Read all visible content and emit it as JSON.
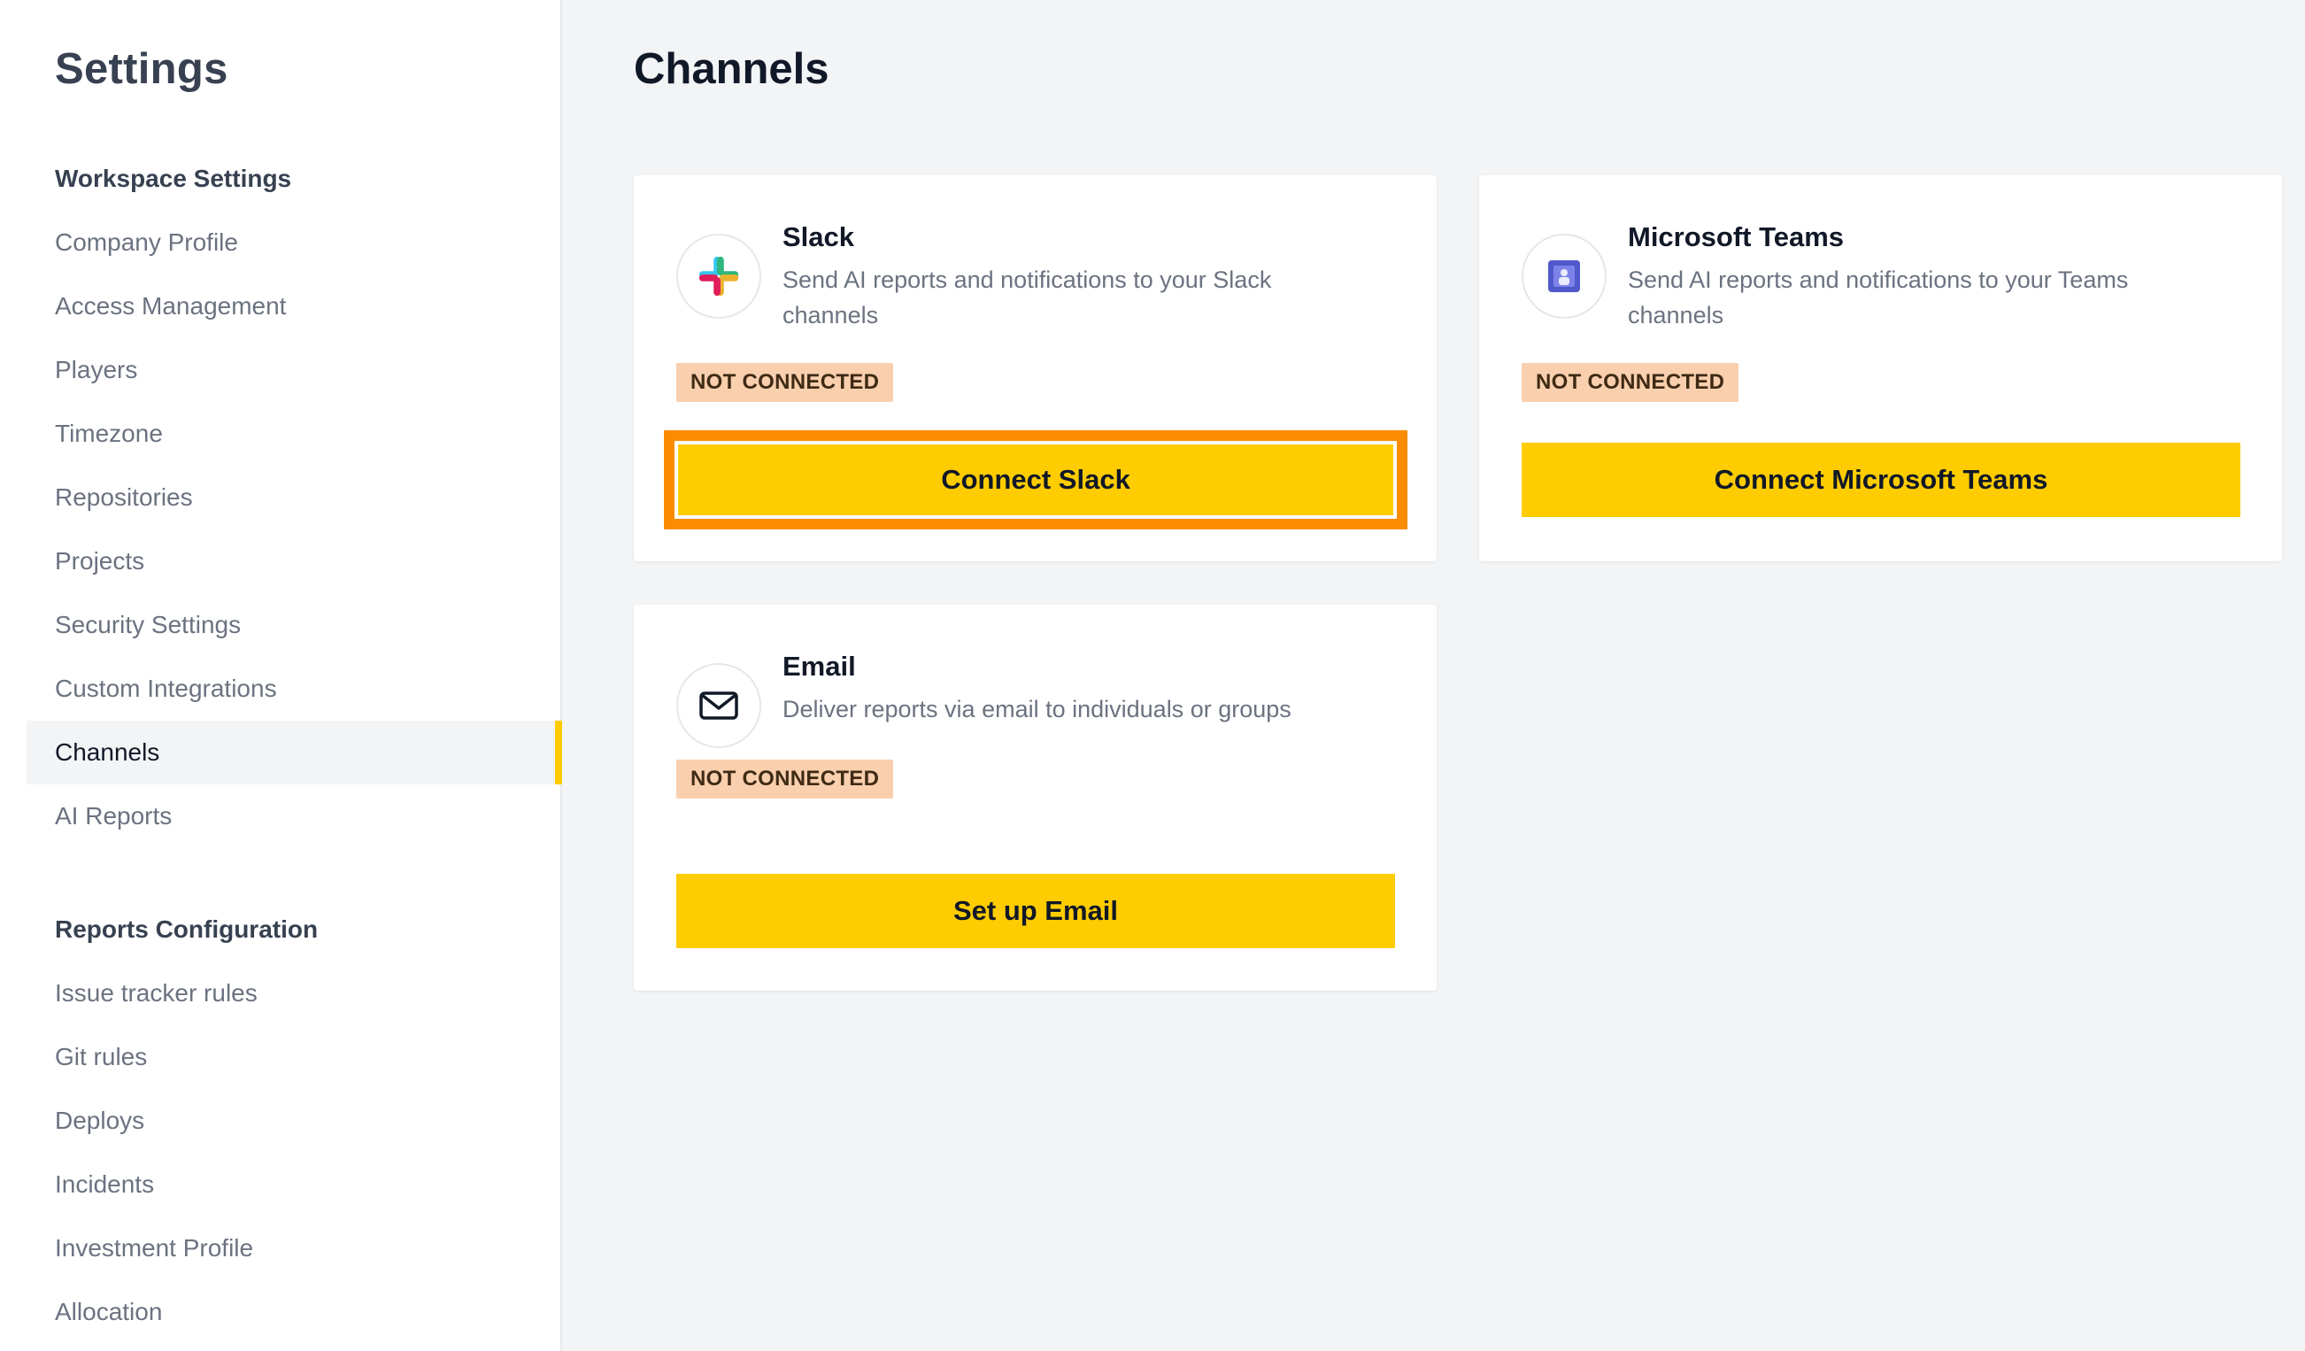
{
  "sidebar": {
    "title": "Settings",
    "sections": [
      {
        "title": "Workspace Settings",
        "items": [
          {
            "label": "Company Profile"
          },
          {
            "label": "Access Management"
          },
          {
            "label": "Players"
          },
          {
            "label": "Timezone"
          },
          {
            "label": "Repositories"
          },
          {
            "label": "Projects"
          },
          {
            "label": "Security Settings"
          },
          {
            "label": "Custom Integrations"
          },
          {
            "label": "Channels",
            "active": true
          },
          {
            "label": "AI Reports"
          }
        ]
      },
      {
        "title": "Reports Configuration",
        "items": [
          {
            "label": "Issue tracker rules"
          },
          {
            "label": "Git rules"
          },
          {
            "label": "Deploys"
          },
          {
            "label": "Incidents"
          },
          {
            "label": "Investment Profile"
          },
          {
            "label": "Allocation"
          }
        ]
      }
    ]
  },
  "main": {
    "title": "Channels",
    "cards": [
      {
        "title": "Slack",
        "description": "Send AI reports and notifications to your Slack channels",
        "status": "NOT CONNECTED",
        "button": "Connect Slack",
        "icon": "slack-icon"
      },
      {
        "title": "Microsoft Teams",
        "description": "Send AI reports and notifications to your Teams channels",
        "status": "NOT CONNECTED",
        "button": "Connect Microsoft Teams",
        "icon": "microsoft-teams-icon"
      },
      {
        "title": "Email",
        "description": "Deliver reports via email to individuals or groups",
        "status": "NOT CONNECTED",
        "button": "Set up Email",
        "icon": "mail-icon"
      }
    ]
  },
  "colors": {
    "accent": "#fecc00",
    "focus_ring": "#fb8c00",
    "badge_bg": "#f9cfae",
    "page_bg": "#f3f4f6"
  }
}
